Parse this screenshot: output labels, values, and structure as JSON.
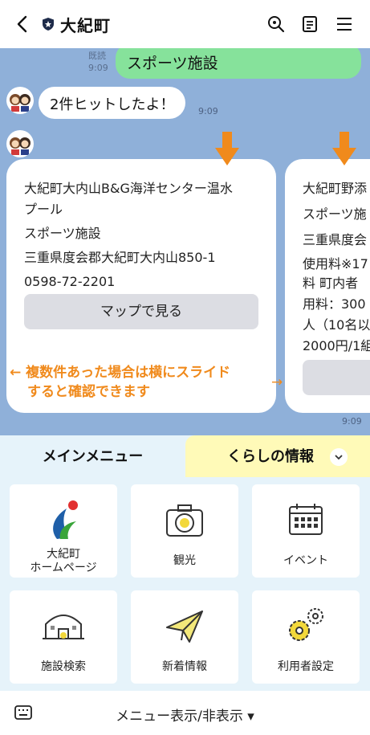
{
  "header": {
    "title": "大紀町",
    "icons": [
      "back-icon",
      "shield-icon",
      "search-icon",
      "notes-icon",
      "menu-icon"
    ]
  },
  "chat": {
    "sent": {
      "read_label": "既読",
      "time": "9:09",
      "text": "スポーツ施設"
    },
    "received": {
      "text": "2件ヒットしたよ！",
      "time": "9:09"
    },
    "cards": [
      {
        "name_line1": "大紀町大内山B&G海洋センター温水",
        "name_line2": "プール",
        "category": "スポーツ施設",
        "address": "三重県度会郡大紀町大内山850-1",
        "phone": "0598-72-2201",
        "map_button": "マップで見る"
      },
      {
        "name_line1": "大紀町野添",
        "category": "スポーツ施",
        "address": "三重県度会",
        "info_line1": "使用料※17",
        "info_line2": "料 町内者",
        "info_line3": "用料：300",
        "info_line4": "人（10名以",
        "info_line5": "2000円/1組"
      }
    ],
    "hint_line1": "← 複数件あった場合は横にスライド",
    "hint_line2": "すると確認できます",
    "hint_arrow": "→",
    "card_time": "9:09"
  },
  "menu": {
    "tab_main": "メインメニュー",
    "tab_life": "くらしの情報",
    "tiles": [
      {
        "label1": "大紀町",
        "label2": "ホームページ",
        "icon": "town-logo-icon"
      },
      {
        "label1": "観光",
        "icon": "camera-icon"
      },
      {
        "label1": "イベント",
        "icon": "calendar-icon"
      },
      {
        "label1": "施設検索",
        "icon": "building-icon"
      },
      {
        "label1": "新着情報",
        "icon": "paper-plane-icon"
      },
      {
        "label1": "利用者設定",
        "icon": "gears-icon"
      }
    ]
  },
  "bottom": {
    "toggle_label": "メニュー表示/非表示 ▾"
  },
  "colors": {
    "chat_bg": "#8fb0d9",
    "sent_bubble": "#86e29b",
    "hint": "#f08a1c",
    "menu_bg": "#e6f3fa",
    "tab_life_bg": "#fffab8"
  }
}
